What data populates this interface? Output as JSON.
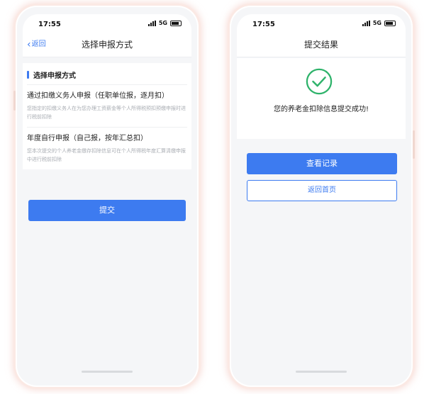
{
  "left_screen": {
    "status": {
      "time": "17:55",
      "network": "5G"
    },
    "nav": {
      "back_label": "返回",
      "title": "选择申报方式"
    },
    "section_title": "选择申报方式",
    "options": [
      {
        "title": "通过扣缴义务人申报（任职单位报，逐月扣）",
        "desc": "您指定的扣缴义务人在为您办理工资薪金等个人所得税预扣预缴申报时进行税前扣除"
      },
      {
        "title": "年度自行申报（自己报，按年汇总扣）",
        "desc": "您本次提交的个人养老金缴存扣除信息可在个人所得税年度汇算清缴申报中进行税前扣除"
      }
    ],
    "submit_label": "提交"
  },
  "right_screen": {
    "status": {
      "time": "17:55",
      "network": "5G"
    },
    "nav": {
      "title": "提交结果"
    },
    "result_message": "您的养老金扣除信息提交成功!",
    "view_records_label": "查看记录",
    "back_home_label": "返回首页"
  },
  "colors": {
    "accent": "#3d7bf0",
    "success": "#2fb36b"
  }
}
